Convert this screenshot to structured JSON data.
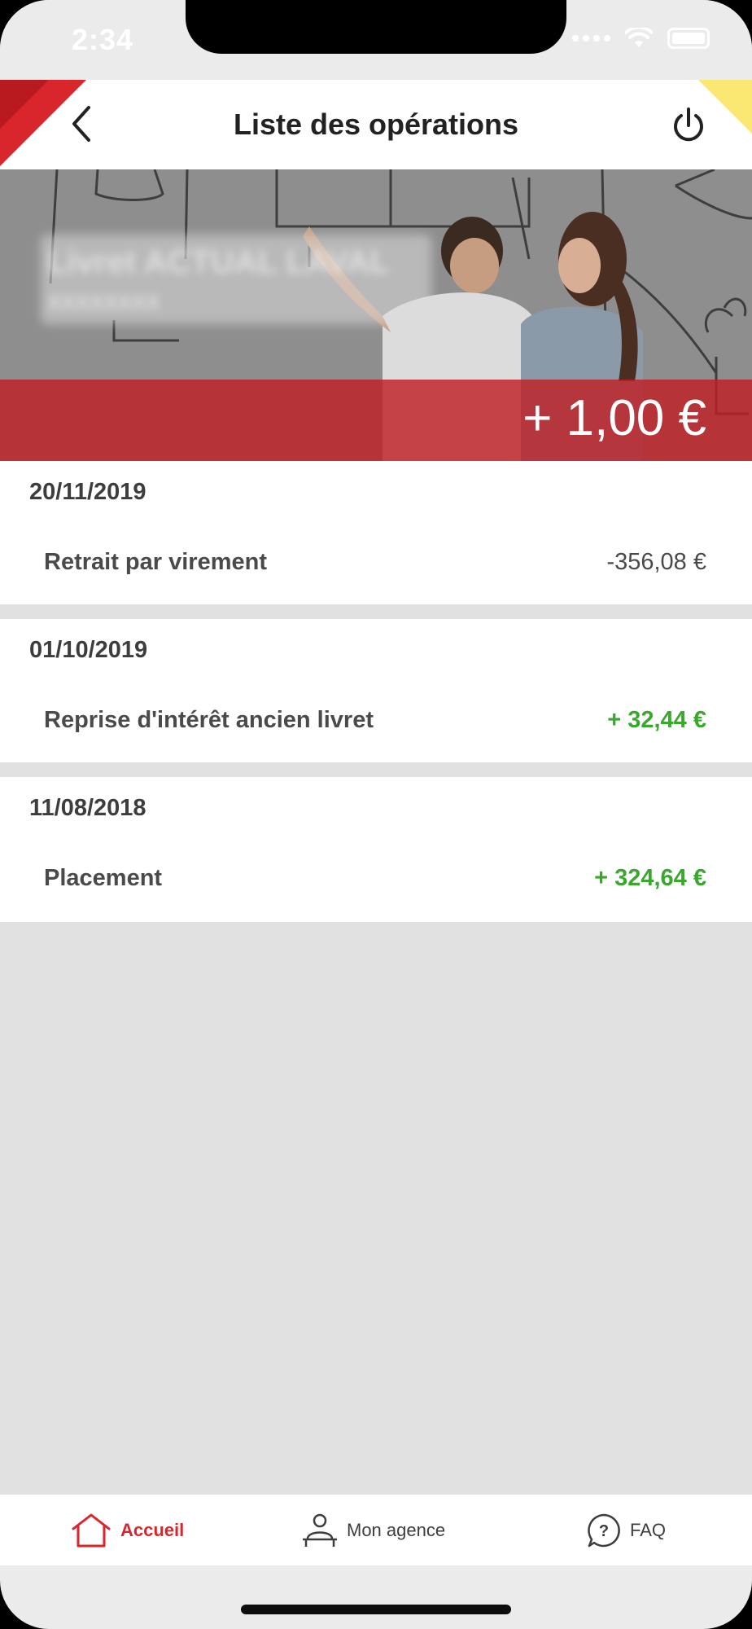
{
  "status_bar": {
    "time": "2:34"
  },
  "header": {
    "title": "Liste des opérations",
    "back_icon": "chevron-left-icon",
    "power_icon": "power-icon"
  },
  "banner": {
    "account_name": "Livret ACTUAL LAVAL",
    "account_number": "XXXXXXXX",
    "balance": "+ 1,00 €"
  },
  "operations": [
    {
      "date": "20/11/2019",
      "label": "Retrait par virement",
      "amount": "-356,08 €",
      "sign": "negative"
    },
    {
      "date": "01/10/2019",
      "label": "Reprise d'intérêt ancien livret",
      "amount": "+ 32,44 €",
      "sign": "positive"
    },
    {
      "date": "11/08/2018",
      "label": "Placement",
      "amount": "+ 324,64 €",
      "sign": "positive"
    }
  ],
  "tab_bar": {
    "tabs": [
      {
        "label": "Accueil",
        "icon": "home-icon",
        "active": true
      },
      {
        "label": "Mon agence",
        "icon": "agent-icon",
        "active": false
      },
      {
        "label": "FAQ",
        "icon": "faq-icon",
        "active": false
      }
    ]
  },
  "colors": {
    "brand_red": "#d8262c",
    "accent_yellow": "#fbe872",
    "positive_green": "#3aa82c"
  }
}
